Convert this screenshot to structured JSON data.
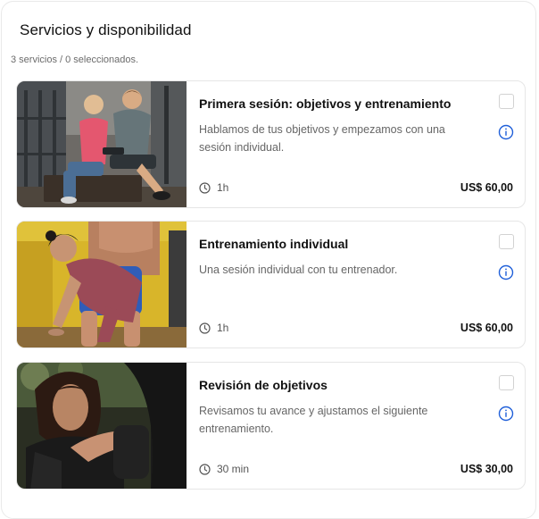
{
  "header": {
    "title": "Servicios y disponibilidad",
    "summary": "3 servicios / 0 seleccionados."
  },
  "services": [
    {
      "title": "Primera sesión: objetivos y entrenamiento",
      "description": "Hablamos de tus objetivos y empezamos con una sesión individual.",
      "duration": "1h",
      "price": "US$ 60,00",
      "selected": false,
      "image_icon": "trainer-consultation-photo"
    },
    {
      "title": "Entrenamiento individual",
      "description": "Una sesión individual con tu entrenador.",
      "duration": "1h",
      "price": "US$ 60,00",
      "selected": false,
      "image_icon": "personal-training-photo"
    },
    {
      "title": "Revisión de objetivos",
      "description": "Revisamos tu avance y ajustamos el siguiente entrenamiento.",
      "duration": "30 min",
      "price": "US$ 30,00",
      "selected": false,
      "image_icon": "boxing-training-photo"
    }
  ],
  "colors": {
    "accent": "#1f5fd9",
    "border": "#e6e6e6",
    "text": "#111111",
    "muted": "#666666"
  }
}
